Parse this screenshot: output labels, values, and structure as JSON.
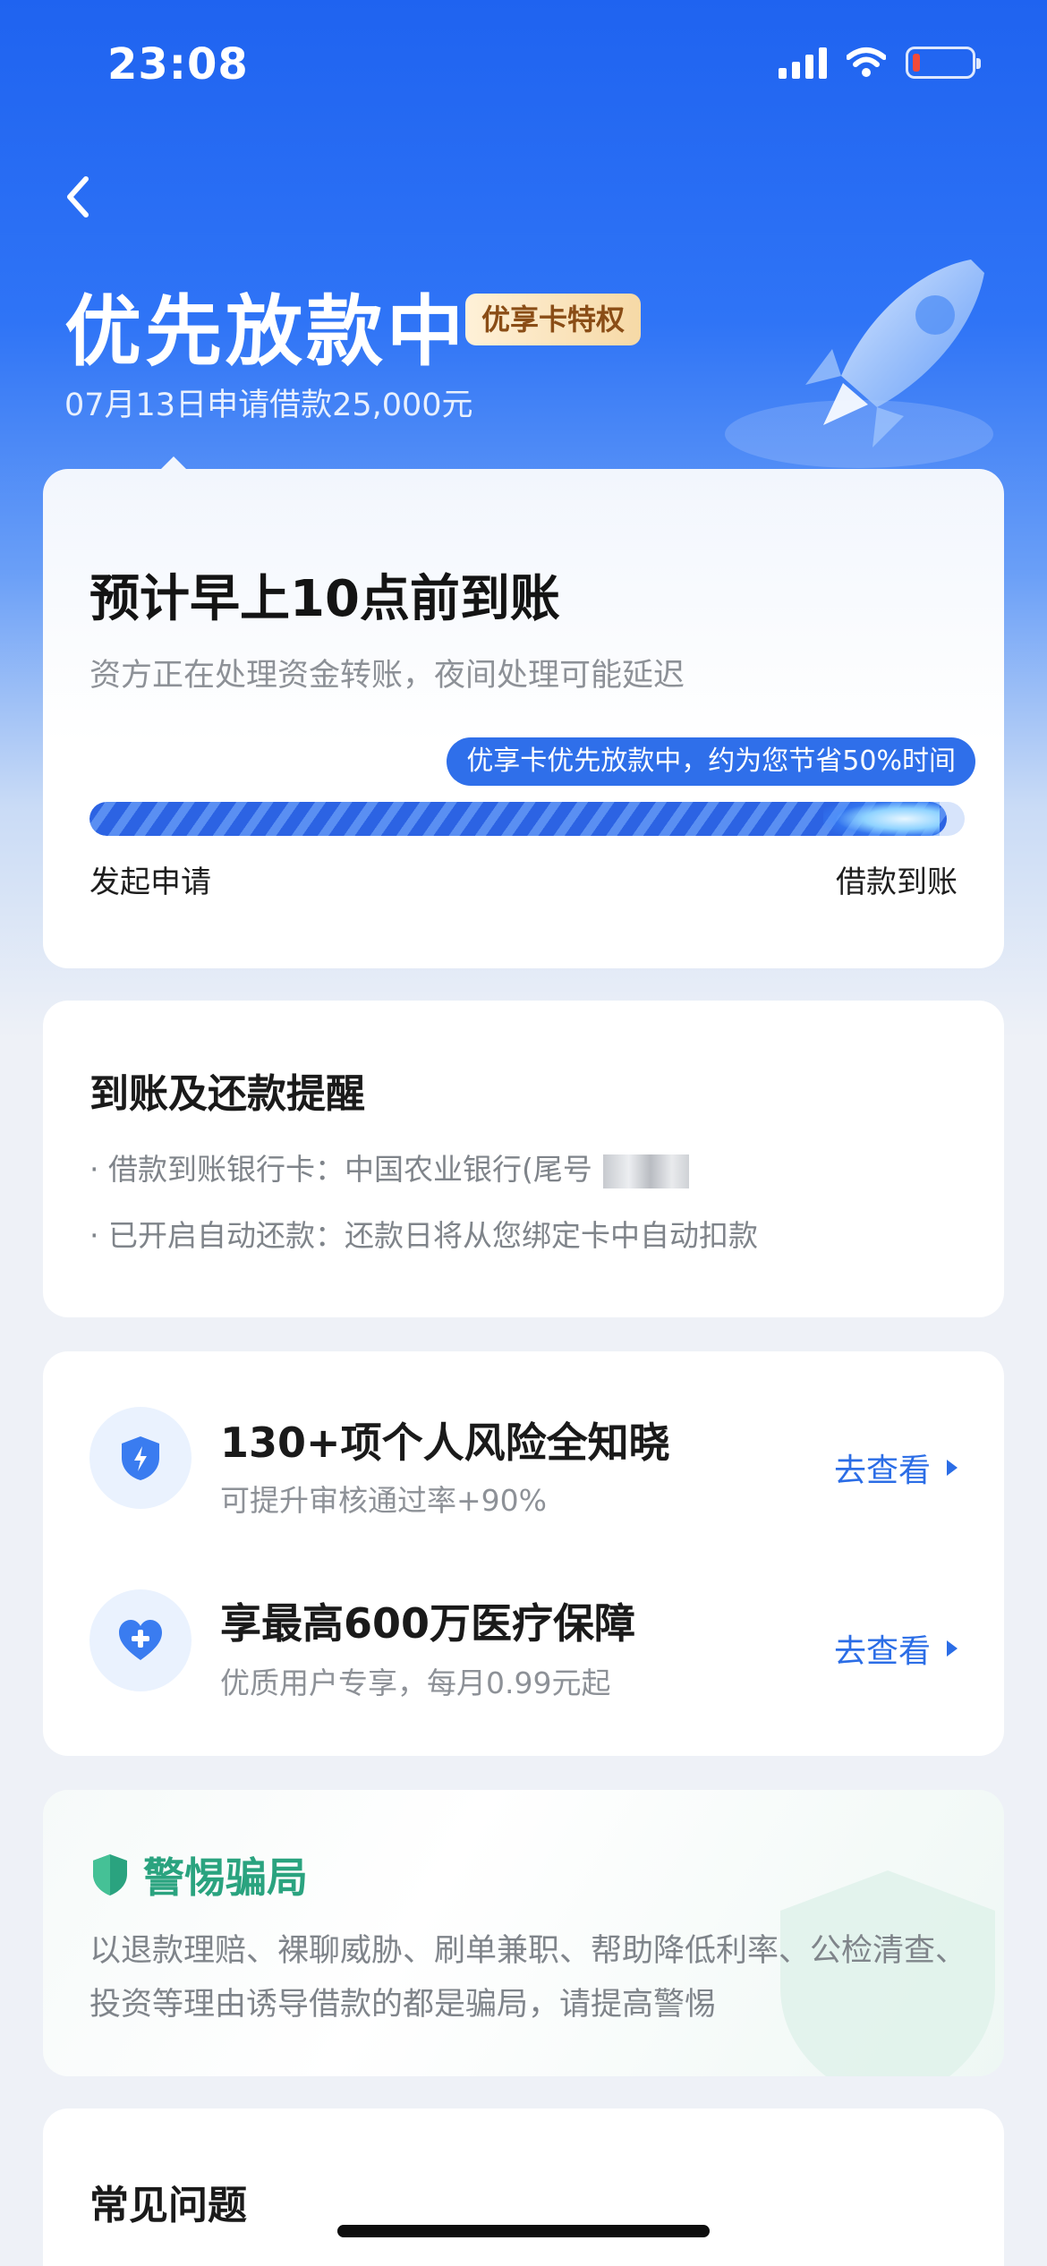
{
  "status_bar": {
    "time": "23:08",
    "battery_level": 0.12
  },
  "header": {
    "title": "优先放款中",
    "badge": "优享卡特权",
    "subtitle": "07月13日申请借款25,000元"
  },
  "progress_card": {
    "eta": "预计早上10点前到账",
    "note": "资方正在处理资金转账，夜间处理可能延迟",
    "tip": "优享卡优先放款中，约为您节省50%时间",
    "progress": 0.98,
    "start_label": "发起申请",
    "end_label": "借款到账"
  },
  "remind_card": {
    "title": "到账及还款提醒",
    "lines": [
      "· 借款到账银行卡：中国农业银行(尾号",
      "· 已开启自动还款：还款日将从您绑定卡中自动扣款"
    ]
  },
  "services": [
    {
      "icon": "shield-lightning-icon",
      "title": "130+项个人风险全知晓",
      "desc": "可提升审核通过率+90%",
      "action": "去查看"
    },
    {
      "icon": "heart-plus-icon",
      "title": "享最高600万医疗保障",
      "desc": "优质用户专享，每月0.99元起",
      "action": "去查看"
    }
  ],
  "fraud_card": {
    "title": "警惕骗局",
    "text": "以退款理赔、裸聊威胁、刷单兼职、帮助降低利率、公检清查、投资等理由诱导借款的都是骗局，请提高警惕"
  },
  "faq_card": {
    "title": "常见问题"
  },
  "colors": {
    "primary": "#2b6de6",
    "safe_green": "#2aa37f",
    "badge_text": "#8a4d16"
  }
}
